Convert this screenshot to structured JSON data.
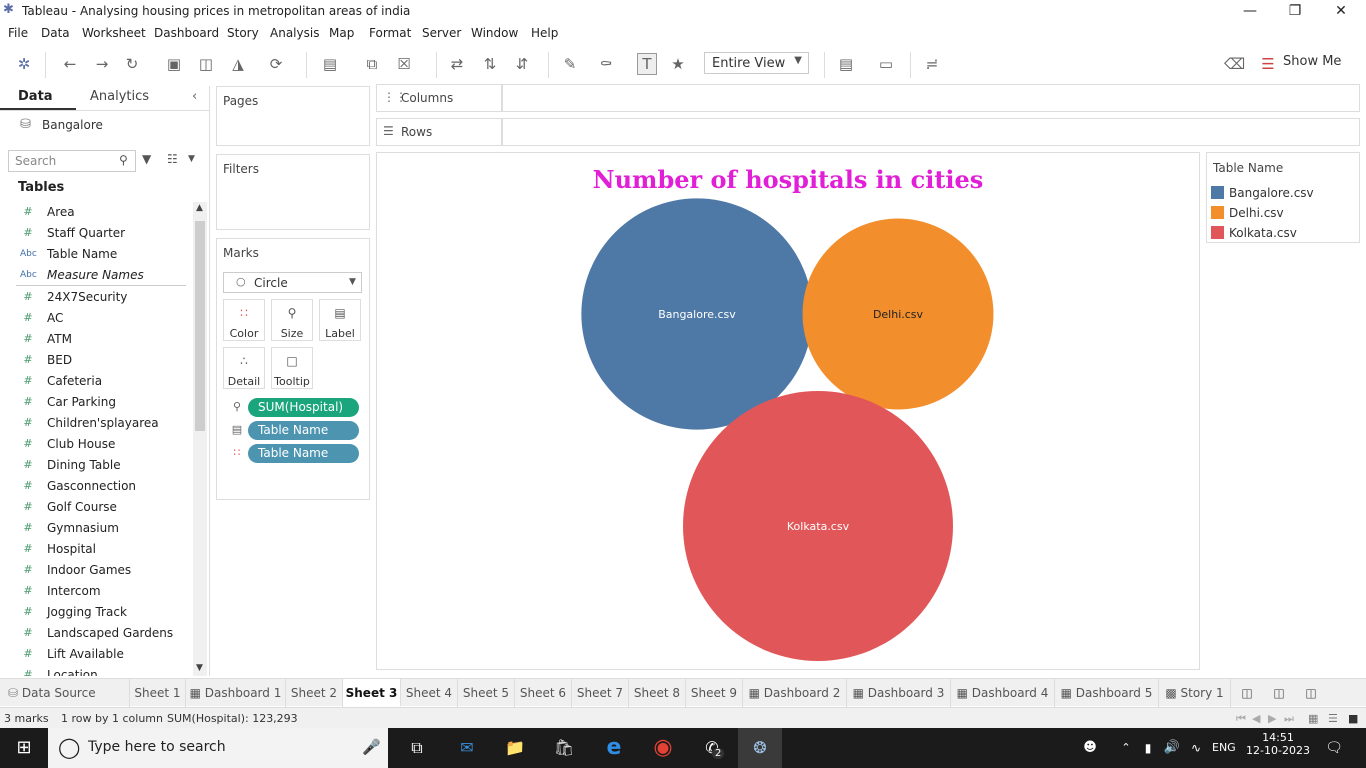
{
  "window": {
    "title": "Tableau - Analysing housing prices in metropolitan areas of india"
  },
  "menu": [
    "File",
    "Data",
    "Worksheet",
    "Dashboard",
    "Story",
    "Analysis",
    "Map",
    "Format",
    "Server",
    "Window",
    "Help"
  ],
  "toolbar": {
    "view_select": "Entire View",
    "show_me": "Show Me"
  },
  "left_pane": {
    "tab_data": "Data",
    "tab_analytics": "Analytics",
    "datasource": "Bangalore",
    "search_placeholder": "Search",
    "tables_heading": "Tables",
    "fields": [
      {
        "name": "Area",
        "type": "measure"
      },
      {
        "name": "Staff Quarter",
        "type": "measure"
      },
      {
        "name": "Table Name",
        "type": "dimension"
      },
      {
        "name": "Measure Names",
        "type": "dimension"
      },
      {
        "name": "24X7Security",
        "type": "measure"
      },
      {
        "name": "AC",
        "type": "measure"
      },
      {
        "name": "ATM",
        "type": "measure"
      },
      {
        "name": "BED",
        "type": "measure"
      },
      {
        "name": "Cafeteria",
        "type": "measure"
      },
      {
        "name": "Car Parking",
        "type": "measure"
      },
      {
        "name": "Children'splayarea",
        "type": "measure"
      },
      {
        "name": "Club House",
        "type": "measure"
      },
      {
        "name": "Dining Table",
        "type": "measure"
      },
      {
        "name": "Gasconnection",
        "type": "measure"
      },
      {
        "name": "Golf Course",
        "type": "measure"
      },
      {
        "name": "Gymnasium",
        "type": "measure"
      },
      {
        "name": "Hospital",
        "type": "measure"
      },
      {
        "name": "Indoor Games",
        "type": "measure"
      },
      {
        "name": "Intercom",
        "type": "measure"
      },
      {
        "name": "Jogging Track",
        "type": "measure"
      },
      {
        "name": "Landscaped Gardens",
        "type": "measure"
      },
      {
        "name": "Lift Available",
        "type": "measure"
      },
      {
        "name": "Location",
        "type": "dimension"
      }
    ]
  },
  "cards": {
    "pages": "Pages",
    "filters": "Filters",
    "marks": "Marks",
    "mark_type": "Circle",
    "mark_buttons": [
      "Color",
      "Size",
      "Label",
      "Detail",
      "Tooltip"
    ],
    "pills": [
      "SUM(Hospital)",
      "Table Name",
      "Table Name"
    ]
  },
  "shelves": {
    "columns": "Columns",
    "rows": "Rows"
  },
  "chart_data": {
    "type": "bubble",
    "title": "Number of hospitals in cities",
    "categories": [
      "Bangalore.csv",
      "Delhi.csv",
      "Kolkata.csv"
    ],
    "values": [
      40500,
      27600,
      55200
    ],
    "total": "123,293",
    "colors": [
      "#4e79a7",
      "#f28e2b",
      "#e15759"
    ],
    "legend_title": "Table Name",
    "legend_position": "right"
  },
  "sheet_tabs": [
    "Data Source",
    "Sheet 1",
    "Dashboard 1",
    "Sheet 2",
    "Sheet 3",
    "Sheet 4",
    "Sheet 5",
    "Sheet 6",
    "Sheet 7",
    "Sheet 8",
    "Sheet 9",
    "Dashboard 2",
    "Dashboard 3",
    "Dashboard 4",
    "Dashboard 5",
    "Story 1"
  ],
  "active_tab": "Sheet 3",
  "status": {
    "marks": "3 marks",
    "rows": "1 row by 1 column",
    "sum": "SUM(Hospital): 123,293"
  },
  "taskbar": {
    "search_placeholder": "Type here to search",
    "lang": "ENG",
    "time": "14:51",
    "date": "12-10-2023",
    "whatsapp_badge": "2"
  }
}
